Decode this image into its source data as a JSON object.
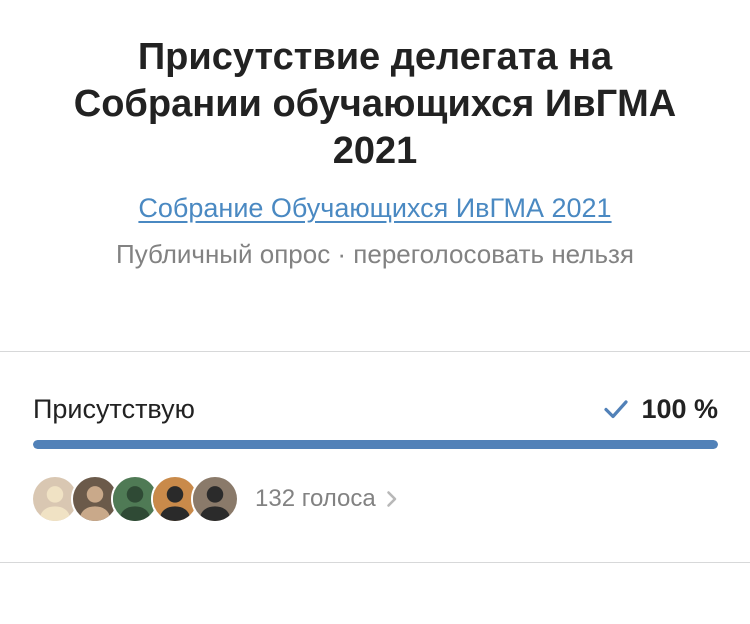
{
  "poll": {
    "title": "Присутствие делегата на Собрании обучающихся ИвГМА 2021",
    "source_link": "Собрание Обучающихся ИвГМА 2021",
    "meta": "Публичный опрос · переголосовать нельзя"
  },
  "options": [
    {
      "label": "Присутствую",
      "percent_text": "100 %",
      "percent_value": 100,
      "selected": true
    }
  ],
  "voters": {
    "count_text": "132 голоса",
    "avatars": [
      {
        "name": "avatar-1",
        "bg": "#d9c7b2",
        "fg": "#f0e2c4"
      },
      {
        "name": "avatar-2",
        "bg": "#6b5a4a",
        "fg": "#c9a98a"
      },
      {
        "name": "avatar-3",
        "bg": "#4f7a55",
        "fg": "#2f4a35"
      },
      {
        "name": "avatar-4",
        "bg": "#c98a4a",
        "fg": "#2a2a2a"
      },
      {
        "name": "avatar-5",
        "bg": "#8a7a6a",
        "fg": "#2b2b2b"
      }
    ]
  },
  "colors": {
    "accent": "#5181b8",
    "link": "#4a89c2",
    "muted": "#828282",
    "text": "#222222"
  },
  "icons": {
    "check": "check-icon",
    "chevron": "chevron-right-icon"
  }
}
